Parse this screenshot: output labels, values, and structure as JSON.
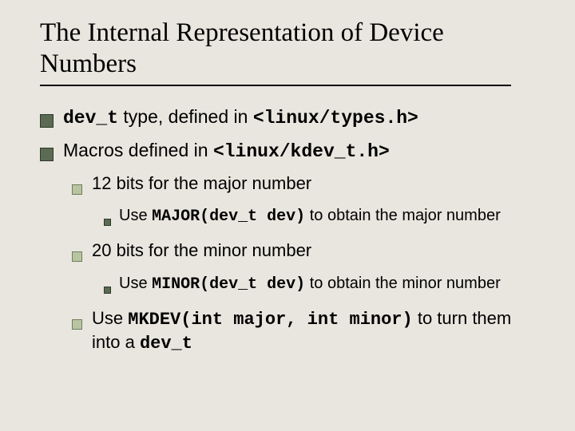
{
  "title": "The Internal Representation of Device Numbers",
  "b1": {
    "pre": "dev_t",
    "mid": "  type, defined in ",
    "code": "<linux/types.h>"
  },
  "b2": {
    "pre": "Macros defined in ",
    "code": "<linux/kdev_t.h>"
  },
  "b2_1": "12 bits for the major number",
  "b2_1_1": {
    "pre": "Use ",
    "code": "MAJOR(dev_t dev)",
    "post": " to obtain the major number"
  },
  "b2_2": "20 bits for the minor number",
  "b2_2_1": {
    "pre": "Use ",
    "code": "MINOR(dev_t dev)",
    "post": " to obtain the minor number"
  },
  "b2_3": {
    "pre": "Use ",
    "code": "MKDEV(int major, int minor)",
    "mid": " to turn them into a ",
    "code2": "dev_t"
  }
}
